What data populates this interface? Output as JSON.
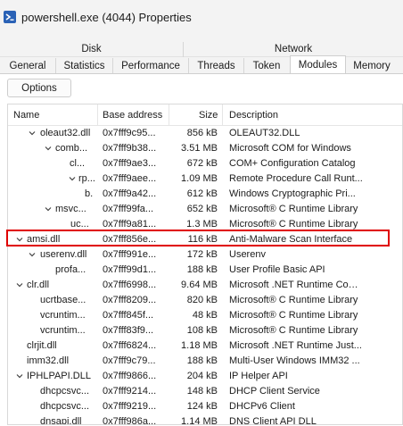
{
  "window": {
    "title": "powershell.exe (4044) Properties"
  },
  "tabs_top": [
    {
      "label": "Disk"
    },
    {
      "label": "Network"
    }
  ],
  "tabs_bottom": [
    {
      "label": "General"
    },
    {
      "label": "Statistics"
    },
    {
      "label": "Performance"
    },
    {
      "label": "Threads"
    },
    {
      "label": "Token"
    },
    {
      "label": "Modules"
    },
    {
      "label": "Memory"
    }
  ],
  "active_tab": "Modules",
  "toolbar": {
    "options_label": "Options"
  },
  "columns": {
    "name": "Name",
    "base": "Base address",
    "size": "Size",
    "desc": "Description"
  },
  "rows": [
    {
      "name": "oleaut32.dll",
      "base": "0x7fff9c95...",
      "size": "856 kB",
      "desc": "OLEAUT32.DLL"
    },
    {
      "name": "comb...",
      "base": "0x7fff9b38...",
      "size": "3.51 MB",
      "desc": "Microsoft COM for Windows"
    },
    {
      "name": "cl...",
      "base": "0x7fff9ae3...",
      "size": "672 kB",
      "desc": "COM+ Configuration Catalog"
    },
    {
      "name": "rp...",
      "base": "0x7fff9aee...",
      "size": "1.09 MB",
      "desc": "Remote Procedure Call Runt..."
    },
    {
      "name": "b.",
      "base": "0x7fff9a42...",
      "size": "612 kB",
      "desc": "Windows Cryptographic Pri..."
    },
    {
      "name": "msvc...",
      "base": "0x7fff99fa...",
      "size": "652 kB",
      "desc": "Microsoft® C Runtime Library"
    },
    {
      "name": "uc...",
      "base": "0x7fff9a81...",
      "size": "1.3 MB",
      "desc": "Microsoft® C Runtime Library"
    },
    {
      "name": "amsi.dll",
      "base": "0x7fff856e...",
      "size": "116 kB",
      "desc": "Anti-Malware Scan Interface"
    },
    {
      "name": "userenv.dll",
      "base": "0x7fff991e...",
      "size": "172 kB",
      "desc": "Userenv"
    },
    {
      "name": "profa...",
      "base": "0x7fff99d1...",
      "size": "188 kB",
      "desc": "User Profile Basic API"
    },
    {
      "name": "clr.dll",
      "base": "0x7fff6998...",
      "size": "9.64 MB",
      "desc": "Microsoft .NET Runtime Com..."
    },
    {
      "name": "ucrtbase...",
      "base": "0x7fff8209...",
      "size": "820 kB",
      "desc": "Microsoft® C Runtime Library"
    },
    {
      "name": "vcruntim...",
      "base": "0x7fff845f...",
      "size": "48 kB",
      "desc": "Microsoft® C Runtime Library"
    },
    {
      "name": "vcruntim...",
      "base": "0x7fff83f9...",
      "size": "108 kB",
      "desc": "Microsoft® C Runtime Library"
    },
    {
      "name": "clrjit.dll",
      "base": "0x7fff6824...",
      "size": "1.18 MB",
      "desc": "Microsoft .NET Runtime Just..."
    },
    {
      "name": "imm32.dll",
      "base": "0x7fff9c79...",
      "size": "188 kB",
      "desc": "Multi-User Windows IMM32 ..."
    },
    {
      "name": "IPHLPAPI.DLL",
      "base": "0x7fff9866...",
      "size": "204 kB",
      "desc": "IP Helper API"
    },
    {
      "name": "dhcpcsvc...",
      "base": "0x7fff9214...",
      "size": "148 kB",
      "desc": "DHCP Client Service"
    },
    {
      "name": "dhcpcsvc...",
      "base": "0x7fff9219...",
      "size": "124 kB",
      "desc": "DHCPv6 Client"
    },
    {
      "name": "dnsapi.dll",
      "base": "0x7fff986a...",
      "size": "1.14 MB",
      "desc": "DNS Client API DLL"
    }
  ]
}
